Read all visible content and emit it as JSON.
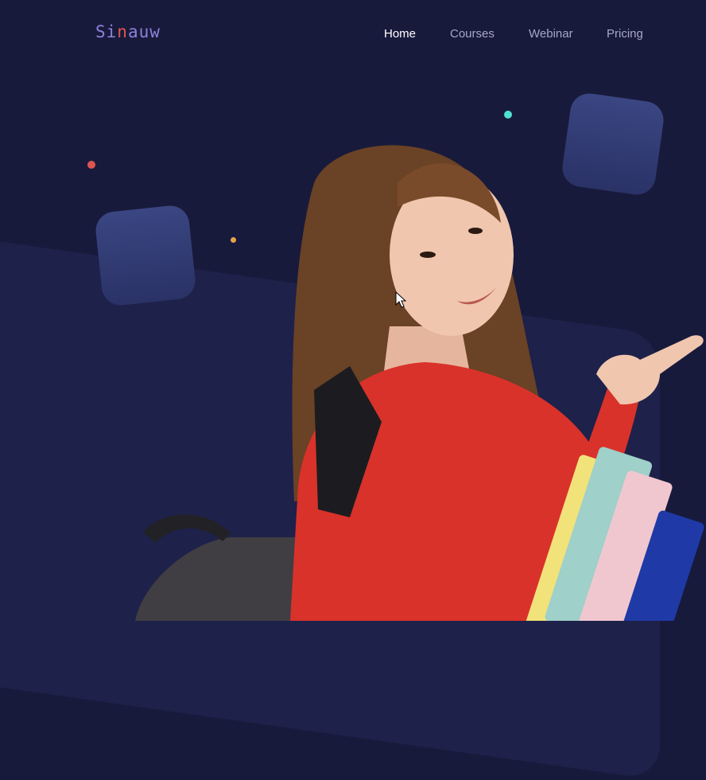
{
  "brand": {
    "name_prefix": "Si",
    "name_accent": "n",
    "name_suffix": "auw"
  },
  "nav": {
    "items": [
      {
        "label": "Home",
        "active": true
      },
      {
        "label": "Courses",
        "active": false
      },
      {
        "label": "Webinar",
        "active": false
      },
      {
        "label": "Pricing",
        "active": false
      }
    ]
  },
  "colors": {
    "background": "#181a3c",
    "panel": "#1e2149",
    "square": "#343f78",
    "dot_red": "#e0554f",
    "dot_teal": "#4fe0cf",
    "dot_orange": "#e8a24a",
    "shirt_red": "#d9322a"
  },
  "hero": {
    "image": "student-girl-red-shirt-pointing-with-books"
  }
}
